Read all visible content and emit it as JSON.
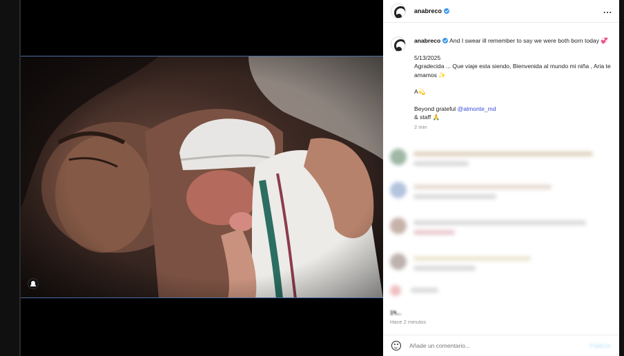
{
  "post": {
    "username": "anabreco",
    "more_label": "...",
    "caption": {
      "username": "anabreco",
      "line1": "And I swear ill remember to say we were both born today 💞",
      "line2": "5/13/2025\nAgradecida ... Que viaje esta siendo, Bienvenida al mundo mi niña , Aria te amamos ✨",
      "line3": "A💫",
      "line4_prefix": "Beyond grateful ",
      "mention": "@almonte_md",
      "line5": "& staff 🙏",
      "time": "2 min"
    },
    "likes": "1٩...",
    "posted_ago": "Hace 2 minutos",
    "comment_placeholder": "Añade un comentario...",
    "publish_label": "Publicar"
  },
  "colors": {
    "verified": "#3897f0",
    "mention": "#3b4bd8",
    "muted": "#8e8e8e"
  },
  "icons": [
    "user-tag-icon",
    "verified-badge-icon",
    "more-options-icon",
    "emoji-icon",
    "avatar"
  ]
}
